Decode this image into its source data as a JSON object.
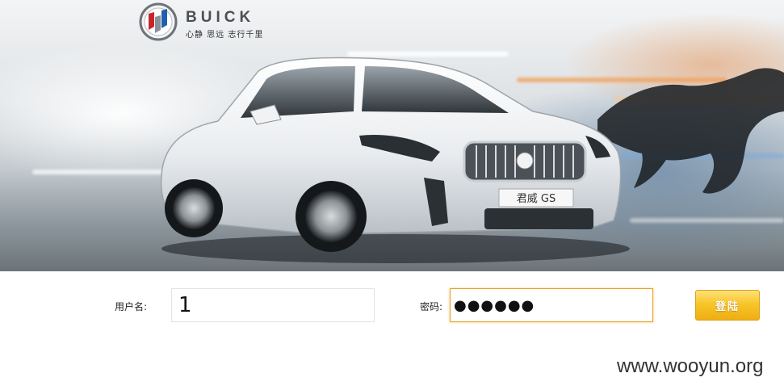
{
  "brand": {
    "name": "BUICK",
    "slogan": "心静 思远 志行千里",
    "emblem_colors": [
      "#c8242b",
      "#1f5fb0",
      "#8a9096"
    ]
  },
  "banner": {
    "car_badge": "君威 GS"
  },
  "login_form": {
    "username_label": "用户名:",
    "username_value": "1",
    "password_label": "密码:",
    "password_value": "●●●●●●",
    "submit_label": "登陆",
    "accent_color": "#e6a020"
  },
  "watermark": "www.wooyun.org"
}
